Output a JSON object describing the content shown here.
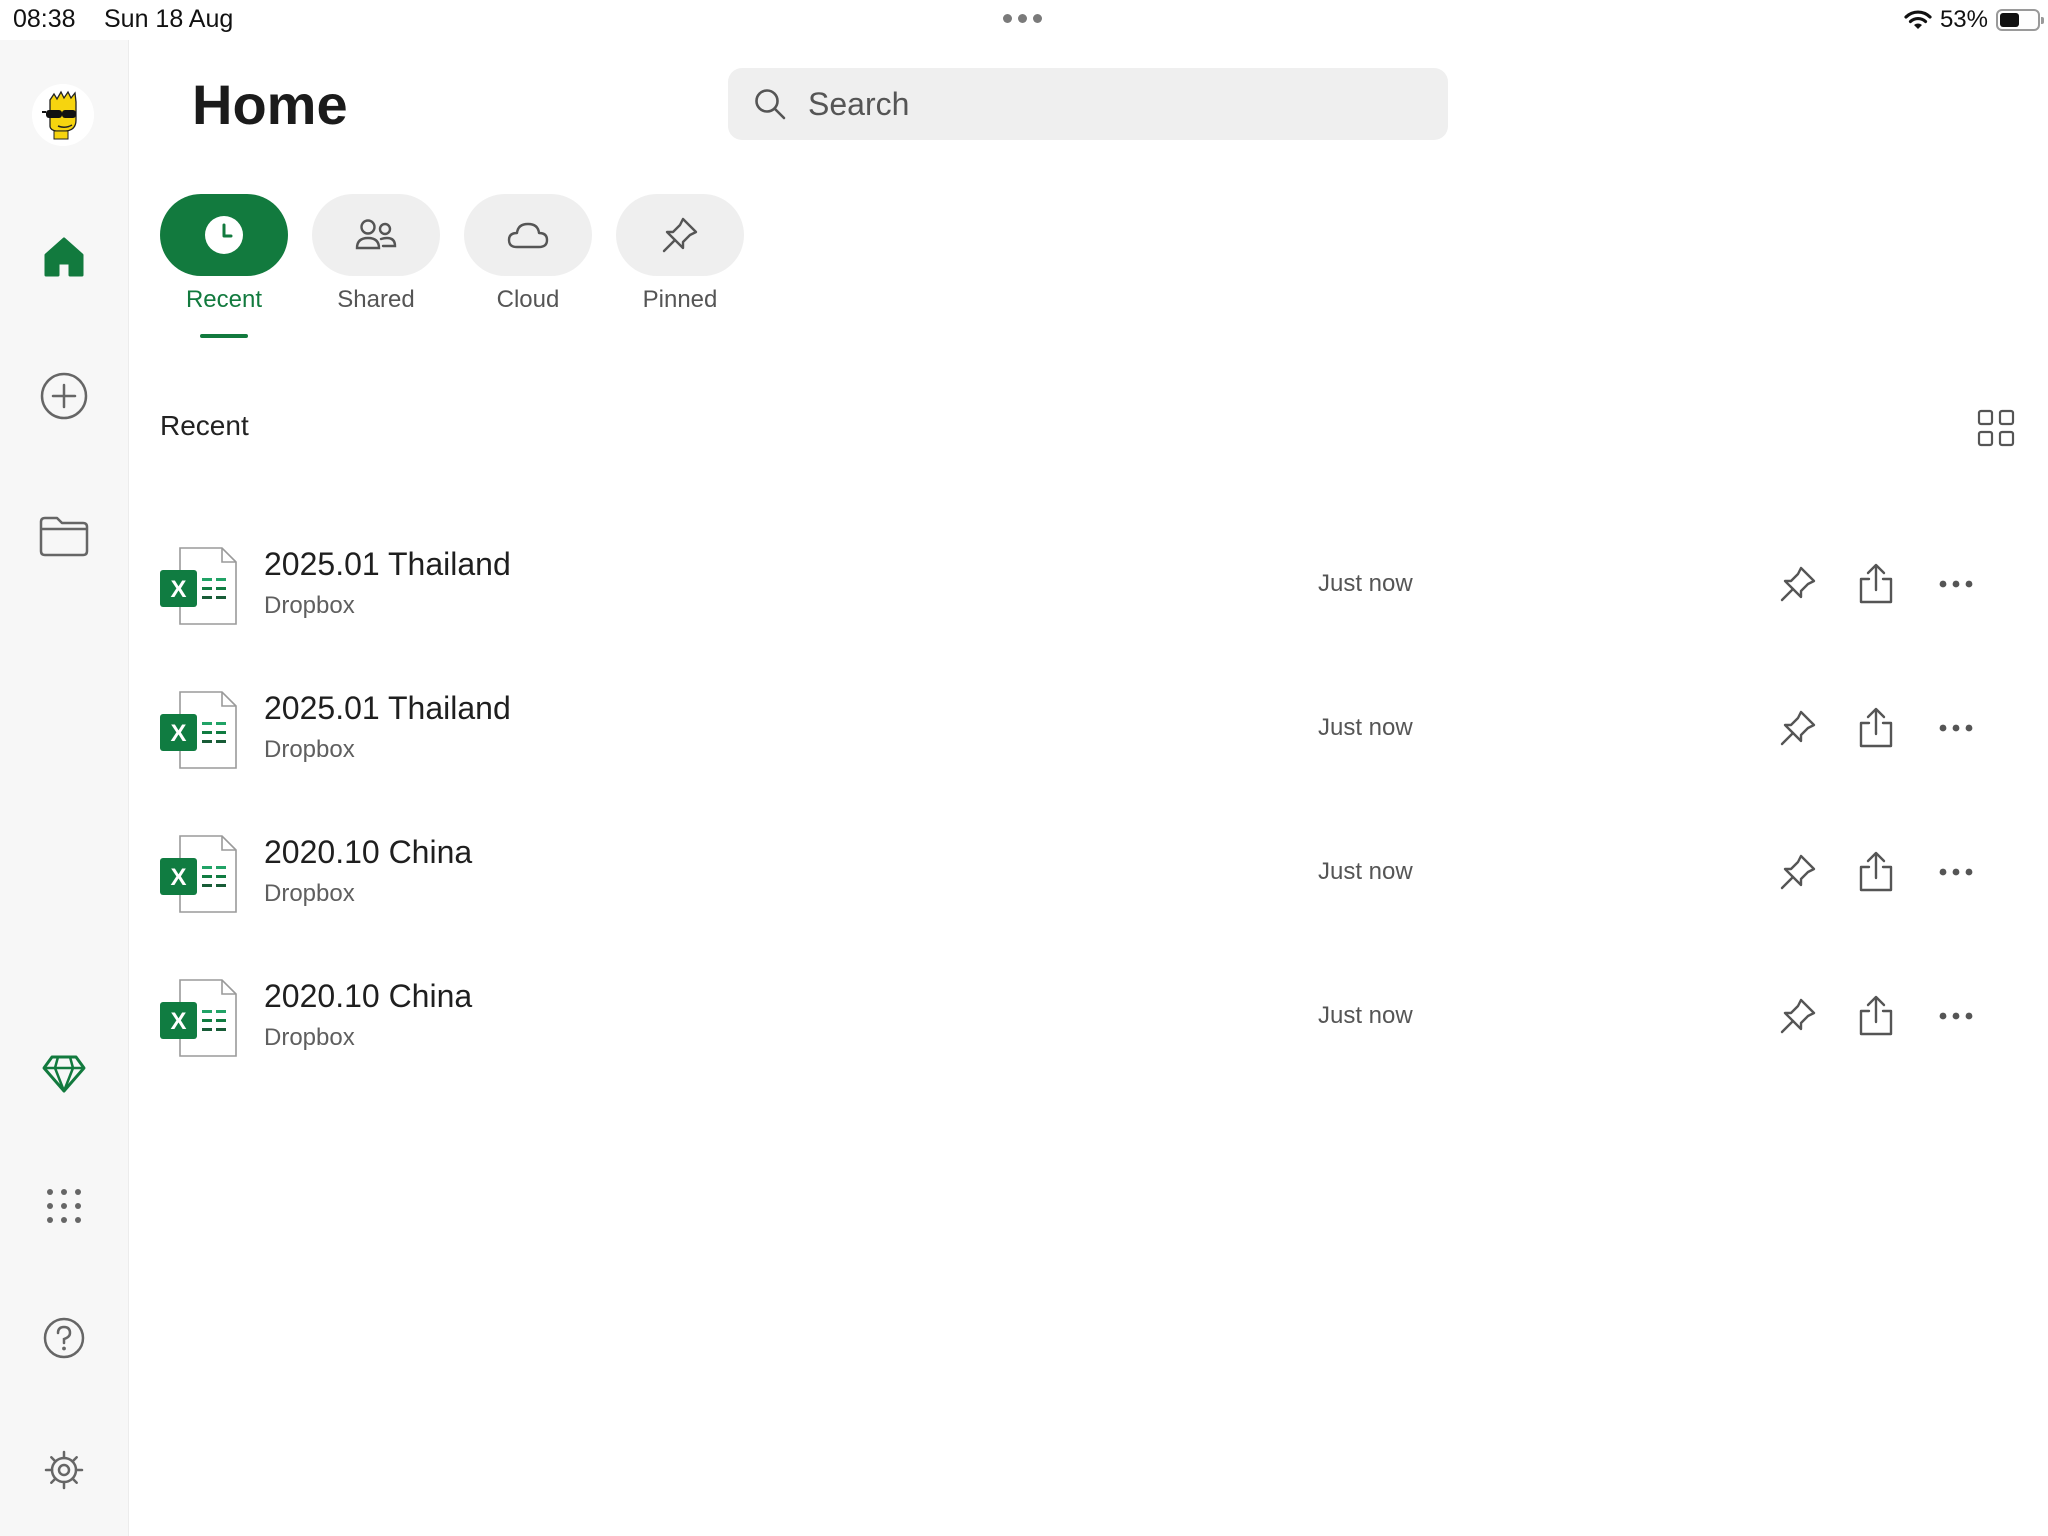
{
  "status_bar": {
    "time": "08:38",
    "date": "Sun 18 Aug",
    "battery": "53%",
    "battery_level": 0.53
  },
  "sidebar": {
    "items": [
      {
        "name": "avatar",
        "icon": "bart-avatar"
      },
      {
        "name": "home",
        "icon": "home-icon",
        "active": true
      },
      {
        "name": "new",
        "icon": "add-circle-icon"
      },
      {
        "name": "open",
        "icon": "folder-icon"
      },
      {
        "name": "premium",
        "icon": "diamond-icon"
      },
      {
        "name": "apps",
        "icon": "app-grid-icon"
      },
      {
        "name": "help",
        "icon": "help-icon"
      },
      {
        "name": "settings",
        "icon": "gear-icon"
      }
    ]
  },
  "header": {
    "title": "Home",
    "search_placeholder": "Search"
  },
  "tabs": [
    {
      "label": "Recent",
      "icon": "clock-icon",
      "active": true
    },
    {
      "label": "Shared",
      "icon": "people-icon",
      "active": false
    },
    {
      "label": "Cloud",
      "icon": "cloud-icon",
      "active": false
    },
    {
      "label": "Pinned",
      "icon": "pin-icon",
      "active": false
    }
  ],
  "section": {
    "title": "Recent"
  },
  "files": [
    {
      "name": "2025.01 Thailand",
      "location": "Dropbox",
      "time": "Just now"
    },
    {
      "name": "2025.01 Thailand",
      "location": "Dropbox",
      "time": "Just now"
    },
    {
      "name": "2020.10 China",
      "location": "Dropbox",
      "time": "Just now"
    },
    {
      "name": "2020.10 China",
      "location": "Dropbox",
      "time": "Just now"
    }
  ],
  "colors": {
    "accent": "#127a3e",
    "excel_green": "#107c41",
    "sidebar_bg": "#f7f7f7",
    "search_bg": "#efefef"
  }
}
